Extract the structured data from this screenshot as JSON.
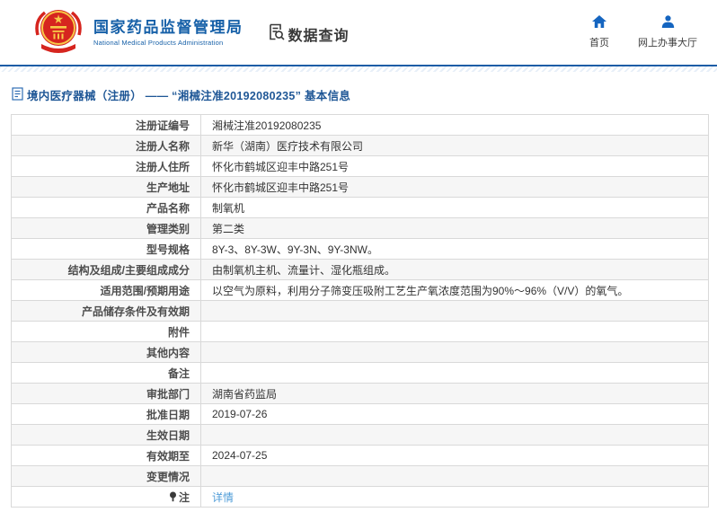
{
  "header": {
    "org_name_cn": "国家药品监督管理局",
    "org_name_en": "National Medical Products Administration",
    "section_label": "数据查询",
    "nav": [
      {
        "icon": "home-icon",
        "label": "首页"
      },
      {
        "icon": "person-icon",
        "label": "网上办事大厅"
      }
    ]
  },
  "page": {
    "title": "境内医疗器械（注册） —— “湘械注准20192080235” 基本信息"
  },
  "table": {
    "rows": [
      {
        "label": "注册证编号",
        "value": "湘械注准20192080235"
      },
      {
        "label": "注册人名称",
        "value": "新华（湖南）医疗技术有限公司"
      },
      {
        "label": "注册人住所",
        "value": "怀化市鹤城区迎丰中路251号"
      },
      {
        "label": "生产地址",
        "value": "怀化市鹤城区迎丰中路251号"
      },
      {
        "label": "产品名称",
        "value": "制氧机"
      },
      {
        "label": "管理类别",
        "value": "第二类"
      },
      {
        "label": "型号规格",
        "value": "8Y-3、8Y-3W、9Y-3N、9Y-3NW。"
      },
      {
        "label": "结构及组成/主要组成成分",
        "value": "由制氧机主机、流量计、湿化瓶组成。"
      },
      {
        "label": "适用范围/预期用途",
        "value": "以空气为原料，利用分子筛变压吸附工艺生产氧浓度范围为90%～96%（V/V）的氧气。"
      },
      {
        "label": "产品储存条件及有效期",
        "value": ""
      },
      {
        "label": "附件",
        "value": ""
      },
      {
        "label": "其他内容",
        "value": ""
      },
      {
        "label": "备注",
        "value": ""
      },
      {
        "label": "审批部门",
        "value": "湖南省药监局"
      },
      {
        "label": "批准日期",
        "value": "2019-07-26"
      },
      {
        "label": "生效日期",
        "value": ""
      },
      {
        "label": "有效期至",
        "value": "2024-07-25"
      },
      {
        "label": "变更情况",
        "value": ""
      },
      {
        "label": "注",
        "value": "详情"
      }
    ]
  },
  "colors": {
    "brand_blue": "#1660a8",
    "header_rule_blue": "#1d5da6",
    "nav_icon_blue": "#1565c0",
    "title_blue": "#1f5796",
    "link_blue": "#4f9cd8",
    "alt_row_bg": "#f6f6f6"
  }
}
